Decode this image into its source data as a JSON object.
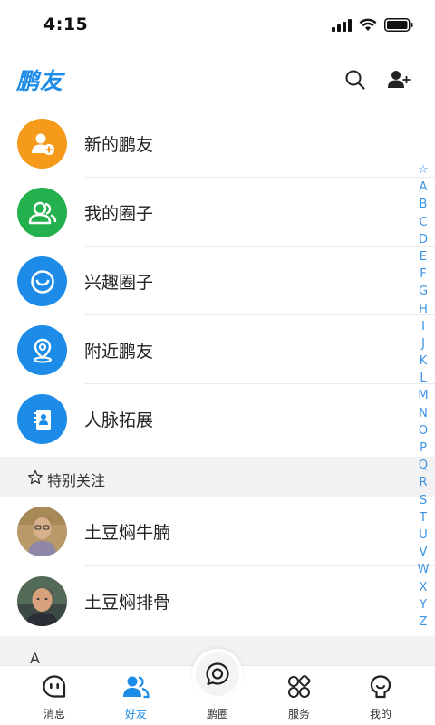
{
  "status_bar": {
    "time": "4:15"
  },
  "header": {
    "logo": "鹏友"
  },
  "features": [
    {
      "label": "新的鹏友",
      "color": "#f59a1b",
      "icon": "new-friend-icon"
    },
    {
      "label": "我的圈子",
      "color": "#23b14d",
      "icon": "my-circle-icon"
    },
    {
      "label": "兴趣圈子",
      "color": "#1c8ce8",
      "icon": "interest-circle-icon"
    },
    {
      "label": "附近鹏友",
      "color": "#1c8ce8",
      "icon": "nearby-location-icon"
    },
    {
      "label": "人脉拓展",
      "color": "#1c8ce8",
      "icon": "contacts-book-icon"
    }
  ],
  "special_section": {
    "title": "特别关注"
  },
  "contacts": [
    {
      "name": "土豆焖牛腩"
    },
    {
      "name": "土豆焖排骨"
    }
  ],
  "section_a": {
    "title": "A"
  },
  "alpha_index": [
    "☆",
    "A",
    "B",
    "C",
    "D",
    "E",
    "F",
    "G",
    "H",
    "I",
    "J",
    "K",
    "L",
    "M",
    "N",
    "O",
    "P",
    "Q",
    "R",
    "S",
    "T",
    "U",
    "V",
    "W",
    "X",
    "Y",
    "Z"
  ],
  "tabs": [
    {
      "label": "消息",
      "icon": "message-face-icon",
      "active": false
    },
    {
      "label": "好友",
      "icon": "friends-icon",
      "active": true
    },
    {
      "label": "鹏圈",
      "icon": "moments-chat-icon",
      "active": false
    },
    {
      "label": "服务",
      "icon": "services-grid-icon",
      "active": false
    },
    {
      "label": "我的",
      "icon": "profile-icon",
      "active": false
    }
  ],
  "colors": {
    "accent": "#1c8ce8",
    "orange": "#f59a1b",
    "green": "#23b14d",
    "section_bg": "#f2f2f2"
  }
}
